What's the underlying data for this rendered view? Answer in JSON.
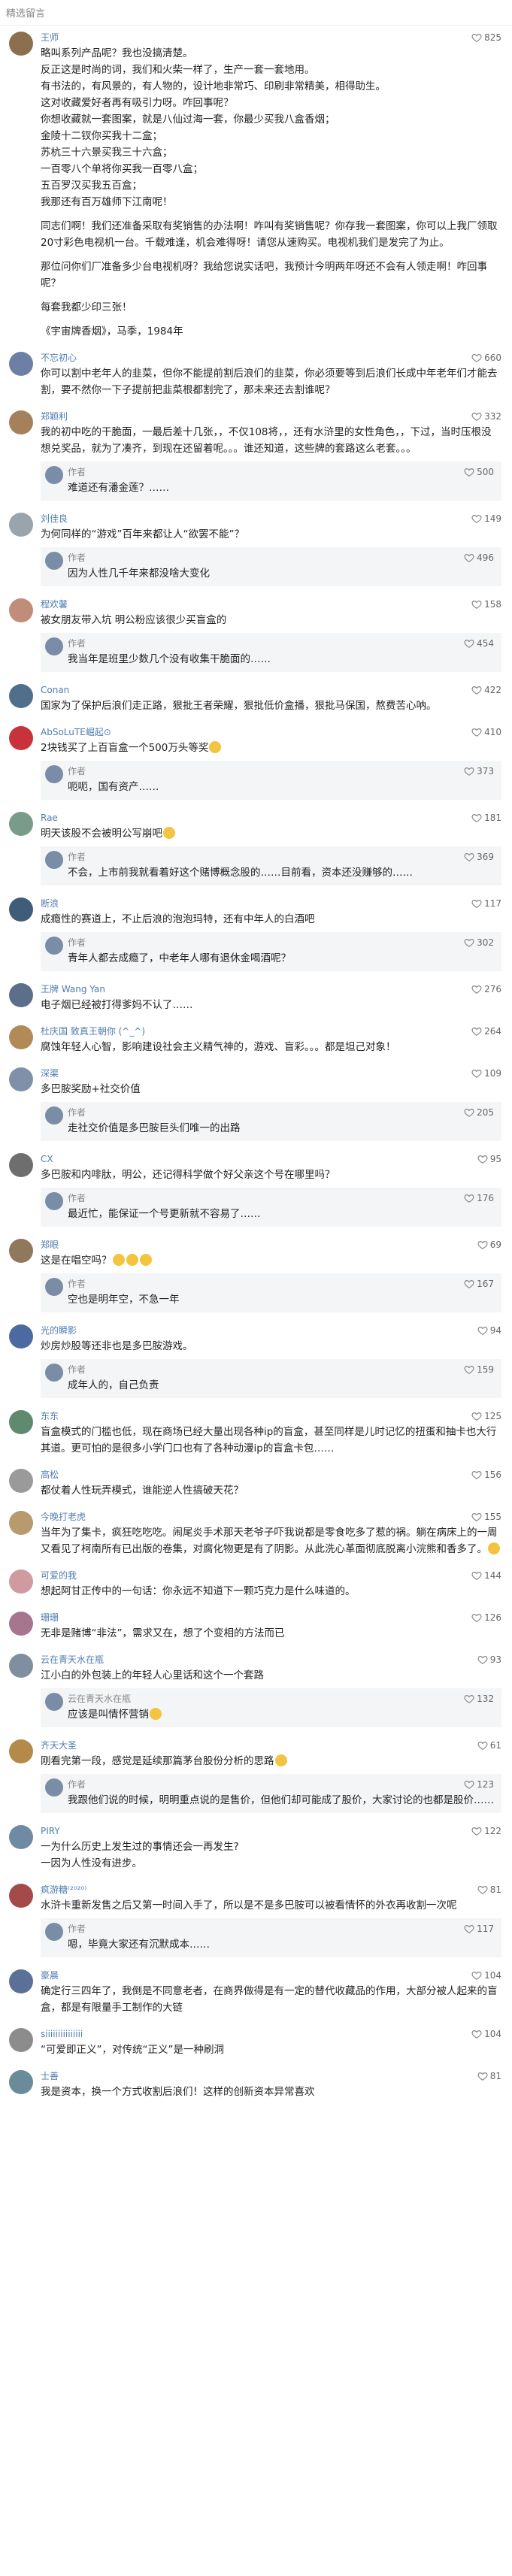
{
  "header_title": "精选留言",
  "comments": [
    {
      "author": "王师",
      "likes": "825",
      "avatar_color": "#8b6f4e",
      "lines": [
        "略叫系列产品呢？我也没搞清楚。",
        "反正这是时尚的词，我们和火柴一样了，生产一套一套地用。",
        "有书法的，有风景的，有人物的，设计地非常巧、印刷非常精美，相得助生。",
        "这对收藏爱好者再有吸引力呀。咋回事呢？",
        "你想收藏就一套图案，就是八仙过海一套，你最少买我八盒香烟；",
        "金陵十二钗你买我十二盒；",
        "苏杭三十六景买我三十六盒；",
        "一百零八个单将你买我一百零八盒；",
        "五百罗汉买我五百盒；",
        "我那还有百万雄师下江南呢！",
        "",
        "同志们啊！我们还准备采取有奖销售的办法啊！咋叫有奖销售呢？你存我一套图案，你可以上我厂领取20寸彩色电视机一台。千载难逢，机会难得呀！请您从速购买。电视机我们是发完了为止。",
        "",
        "那位问你们厂准备多少台电视机呀？我给您说实话吧，我预计今明两年呀还不会有人领走啊！咋回事呢？",
        "",
        "每套我都少印三张！",
        "",
        "《宇宙牌香烟》，马季，1984年"
      ],
      "replies": []
    },
    {
      "author": "不忘初心",
      "likes": "660",
      "avatar_color": "#6d7fa6",
      "lines": [
        "你可以割中老年人的韭菜，但你不能提前割后浪们的韭菜，你必须要等到后浪们长成中年老年们才能去割，要不然你一下子提前把韭菜根都割完了，那未来还去割谁呢？"
      ],
      "replies": []
    },
    {
      "author": "郑颖利",
      "likes": "332",
      "avatar_color": "#a4815b",
      "lines": [
        "我的初中吃的干脆面，一最后差十几张，，不仅108将，，还有水浒里的女性角色，，下过，当时压根没想兑奖品，就为了凑齐，到现在还留着呢。。。谁还知道，这些牌的套路这么老套。。。"
      ],
      "replies": [
        {
          "author": "作者",
          "likes": "500",
          "text": "难道还有潘金莲？……"
        }
      ]
    },
    {
      "author": "刘佳良",
      "likes": "149",
      "avatar_color": "#9aa4ad",
      "lines": [
        "为何同样的“游戏”百年来都让人“欲罢不能”？"
      ],
      "replies": [
        {
          "author": "作者",
          "likes": "496",
          "text": "因为人性几千年来都没啥大变化"
        }
      ]
    },
    {
      "author": "程欢馨",
      "likes": "158",
      "avatar_color": "#c08d7a",
      "lines": [
        "被女朋友带入坑 明公粉应该很少买盲盒的"
      ],
      "replies": [
        {
          "author": "作者",
          "likes": "454",
          "text": "我当年是班里少数几个没有收集干脆面的……"
        }
      ]
    },
    {
      "author": "Conan",
      "likes": "422",
      "avatar_color": "#4f6f8c",
      "lines": [
        "国家为了保护后浪们走正路，狠批王者荣耀，狠批低价盒播，狠批马保国，熬费苦心呐。"
      ],
      "replies": []
    },
    {
      "author": "AbSoLuTE崛起⊙",
      "likes": "410",
      "avatar_color": "#c8323a",
      "lines": [
        "2块钱买了上百盲盒一个500万头等奖[emoji]"
      ],
      "replies": [
        {
          "author": "作者",
          "likes": "373",
          "text": "呃呃，国有资产……"
        }
      ]
    },
    {
      "author": "Rae",
      "likes": "181",
      "avatar_color": "#7a9b88",
      "lines": [
        "明天该股不会被明公写崩吧[emoji]"
      ],
      "replies": [
        {
          "author": "作者",
          "likes": "369",
          "text": "不会，上市前我就看着好这个赌博概念股的……目前看，资本还没赚够的……"
        }
      ]
    },
    {
      "author": "断浪",
      "likes": "117",
      "avatar_color": "#3f5d78",
      "lines": [
        "成瘾性的赛道上，不止后浪的泡泡玛特，还有中年人的白酒吧"
      ],
      "replies": [
        {
          "author": "作者",
          "likes": "302",
          "text": "青年人都去成瘾了，中老年人哪有退休金喝酒呢？"
        }
      ]
    },
    {
      "author": "王牌 Wang Yan",
      "likes": "276",
      "avatar_color": "#5d6e8a",
      "lines": [
        "电子烟已经被打得爹妈不认了……"
      ],
      "replies": []
    },
    {
      "author": "杜庆国 致真王朝你 (^_^)",
      "likes": "264",
      "avatar_color": "#b28a58",
      "lines": [
        "腐蚀年轻人心智，影响建设社会主义精气神的，游戏、盲彩。。。都是坦己对象！"
      ],
      "replies": []
    },
    {
      "author": "深渠",
      "likes": "109",
      "avatar_color": "#8090a8",
      "lines": [
        "多巴胺奖励+社交价值"
      ],
      "replies": [
        {
          "author": "作者",
          "likes": "205",
          "text": "走社交价值是多巴胺巨头们唯一的出路"
        }
      ]
    },
    {
      "author": "CX",
      "likes": "95",
      "avatar_color": "#6e6e6e",
      "lines": [
        "多巴胺和内啡肽，明公，还记得科学做个好父亲这个号在哪里吗？"
      ],
      "replies": [
        {
          "author": "作者",
          "likes": "176",
          "text": "最近忙，能保证一个号更新就不容易了……"
        }
      ]
    },
    {
      "author": "郑眼",
      "likes": "69",
      "avatar_color": "#90785d",
      "lines": [
        "这是在唱空吗？[emoji][emoji][emoji]"
      ],
      "replies": [
        {
          "author": "作者",
          "likes": "167",
          "text": "空也是明年空，不急一年"
        }
      ]
    },
    {
      "author": "光的瞬影",
      "likes": "94",
      "avatar_color": "#4b6aa0",
      "lines": [
        "炒房炒股等还非也是多巴胺游戏。"
      ],
      "replies": [
        {
          "author": "作者",
          "likes": "159",
          "text": "成年人的，自己负责"
        }
      ]
    },
    {
      "author": "东东",
      "likes": "125",
      "avatar_color": "#5f8a6e",
      "lines": [
        "盲盒模式的门槛也低，现在商场已经大量出现各种ip的盲盒，甚至同样是儿时记忆的扭蛋和抽卡也大行其道。更可怕的是很多小学门口也有了各种动漫ip的盲盒卡包……"
      ],
      "replies": []
    },
    {
      "author": "高松",
      "likes": "156",
      "avatar_color": "#9a9a9a",
      "lines": [
        "都仗着人性玩弄模式，谁能逆人性搞破天花？"
      ],
      "replies": []
    },
    {
      "author": "今晚打老虎",
      "likes": "155",
      "avatar_color": "#b79a6d",
      "lines": [
        "当年为了集卡，疯狂吃吃吃。闹尾炎手术那天老爷子吓我说都是零食吃多了惹的祸。躺在病床上的一周又看见了柯南所有已出版的卷集，对腐化物更是有了阴影。从此洗心革面彻底脱离小浣熊和香多了。[emoji]"
      ],
      "replies": []
    },
    {
      "author": "可爱的我",
      "likes": "144",
      "avatar_color": "#cf9aa0",
      "lines": [
        "想起阿甘正传中的一句话：你永远不知道下一颗巧克力是什么味道的。"
      ],
      "replies": []
    },
    {
      "author": "珊珊",
      "likes": "126",
      "avatar_color": "#a6768f",
      "lines": [
        "无非是赌博“非法”，需求又在，想了个变相的方法而已"
      ],
      "replies": []
    },
    {
      "author": "云在青天水在瓶",
      "likes": "93",
      "avatar_color": "#7f8f9f",
      "lines": [
        "江小白的外包装上的年轻人心里话和这个一个套路"
      ],
      "replies": [
        {
          "author": "云在青天水在瓶",
          "likes": "132",
          "text": "应该是叫情怀营销[emoji]"
        }
      ]
    },
    {
      "author": "齐天大圣",
      "likes": "61",
      "avatar_color": "#b38a4a",
      "lines": [
        "刚看完第一段，感觉是延续那篇茅台股份分析的思路[emoji]"
      ],
      "replies": [
        {
          "author": "作者",
          "likes": "123",
          "text": "我跟他们说的时候，明明重点说的是售价，但他们却可能成了股价，大家讨论的也都是股价……"
        }
      ]
    },
    {
      "author": "PIRY",
      "likes": "122",
      "avatar_color": "#6f8aa3",
      "lines": [
        "一为什么历史上发生过的事情还会一再发生?",
        "一因为人性没有进步。"
      ],
      "replies": []
    },
    {
      "author": "疯游糖⁽²⁰²⁰⁾",
      "likes": "81",
      "avatar_color": "#a54a4a",
      "lines": [
        "水浒卡重新发售之后又第一时间入手了，所以是不是多巴胺可以被看情怀的外衣再收割一次呢"
      ],
      "replies": [
        {
          "author": "作者",
          "likes": "117",
          "text": "嗯，毕竟大家还有沉默成本……"
        }
      ]
    },
    {
      "author": "豪晨",
      "likes": "104",
      "avatar_color": "#5a7096",
      "lines": [
        "确定行三四年了，我倒是不同意老者，在商界做得是有一定的替代收藏品的作用，大部分被人起来的盲盒，都是有限量手工制作的大链"
      ],
      "replies": []
    },
    {
      "author": "siiiiiiiiiiiiiii",
      "likes": "104",
      "avatar_color": "#8c8c8c",
      "lines": [
        "“可爱即正义”，对传统“正义”是一种刷洞"
      ],
      "replies": []
    },
    {
      "author": "士善",
      "likes": "81",
      "avatar_color": "#6a8c9a",
      "lines": [
        "我是资本，换一个方式收割后浪们！这样的创新资本异常喜欢"
      ],
      "replies": []
    }
  ]
}
